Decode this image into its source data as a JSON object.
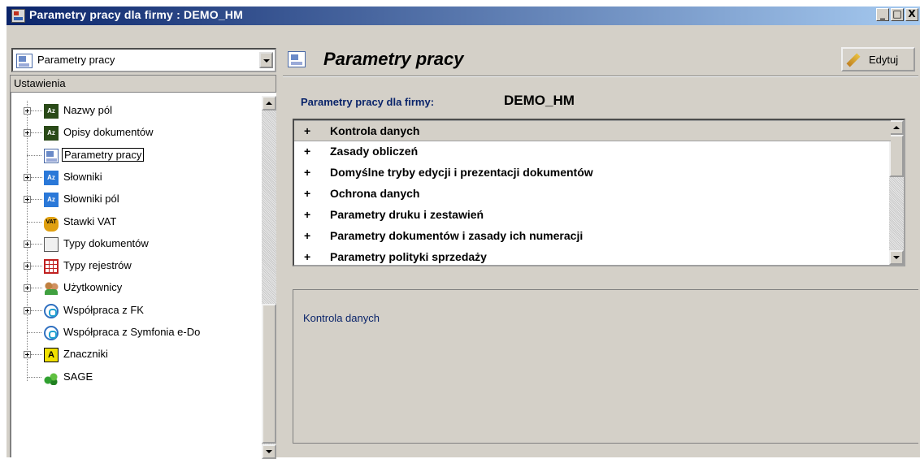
{
  "window": {
    "title": "Parametry pracy dla firmy : DEMO_HM",
    "controls": {
      "minimize": "_",
      "maximize": "□",
      "close": "X"
    }
  },
  "left_panel": {
    "combo_value": "Parametry pracy",
    "section_header": "Ustawienia",
    "tree_items": [
      {
        "label": "Nazwy pól",
        "icon": "az-dictionary-icon",
        "expandable": true
      },
      {
        "label": "Opisy dokumentów",
        "icon": "az-dictionary-icon",
        "expandable": true
      },
      {
        "label": "Parametry pracy",
        "icon": "parameters-icon",
        "expandable": false,
        "selected": true
      },
      {
        "label": "Słowniki",
        "icon": "az-blue-icon",
        "expandable": true
      },
      {
        "label": "Słowniki pól",
        "icon": "az-blue-icon",
        "expandable": true
      },
      {
        "label": "Stawki VAT",
        "icon": "vat-icon",
        "icon_text": "VAT",
        "expandable": false
      },
      {
        "label": "Typy dokumentów",
        "icon": "document-types-icon",
        "expandable": true
      },
      {
        "label": "Typy rejestrów",
        "icon": "registers-icon",
        "expandable": true
      },
      {
        "label": "Użytkownicy",
        "icon": "users-icon",
        "expandable": true
      },
      {
        "label": "Współpraca z FK",
        "icon": "sync-icon",
        "expandable": true
      },
      {
        "label": "Współpraca z Symfonia e-Do",
        "icon": "sync-icon",
        "expandable": false
      },
      {
        "label": "Znaczniki",
        "icon": "tag-icon",
        "icon_text": "A",
        "expandable": true
      },
      {
        "label": "SAGE",
        "icon": "sage-icon",
        "expandable": false
      }
    ]
  },
  "right_panel": {
    "title": "Parametry pracy",
    "edit_button": "Edytuj",
    "company_label": "Parametry pracy dla firmy:",
    "company_value": "DEMO_HM",
    "sections": [
      {
        "marker": "+",
        "label": "Kontrola danych",
        "selected": true
      },
      {
        "marker": "+",
        "label": "Zasady obliczeń"
      },
      {
        "marker": "+",
        "label": "Domyślne tryby edycji i prezentacji dokumentów"
      },
      {
        "marker": "+",
        "label": "Ochrona danych"
      },
      {
        "marker": "+",
        "label": "Parametry druku i zestawień"
      },
      {
        "marker": "+",
        "label": "Parametry dokumentów i zasady ich numeracji"
      },
      {
        "marker": "+",
        "label": "Parametry polityki sprzedaży"
      }
    ],
    "description": "Kontrola danych"
  },
  "colors": {
    "title_bar_start": "#0a246a",
    "title_bar_end": "#a6caf0",
    "accent_text": "#0a246a",
    "window_face": "#d4d0c8"
  }
}
